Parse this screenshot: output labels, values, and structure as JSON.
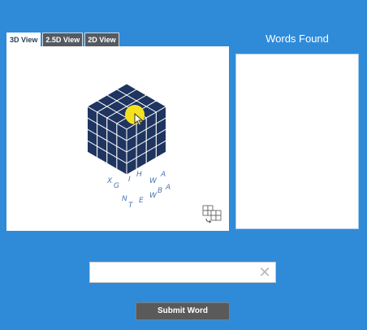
{
  "tabs": [
    {
      "label": "3D View",
      "active": true
    },
    {
      "label": "2.5D View",
      "active": false
    },
    {
      "label": "2D View",
      "active": false
    }
  ],
  "words_found": {
    "title": "Words Found",
    "items": []
  },
  "cube": {
    "visible_letters": [
      "X",
      "G",
      "I",
      "H",
      "W",
      "A",
      "N",
      "T",
      "E",
      "W",
      "B",
      "A"
    ]
  },
  "word_input": {
    "value": "",
    "placeholder": ""
  },
  "submit_button": {
    "label": "Submit Word"
  },
  "colors": {
    "background": "#2f8bd8",
    "cube": "#1f3560",
    "cursor_highlight": "#f5e21e",
    "tab_inactive": "#555a60"
  }
}
